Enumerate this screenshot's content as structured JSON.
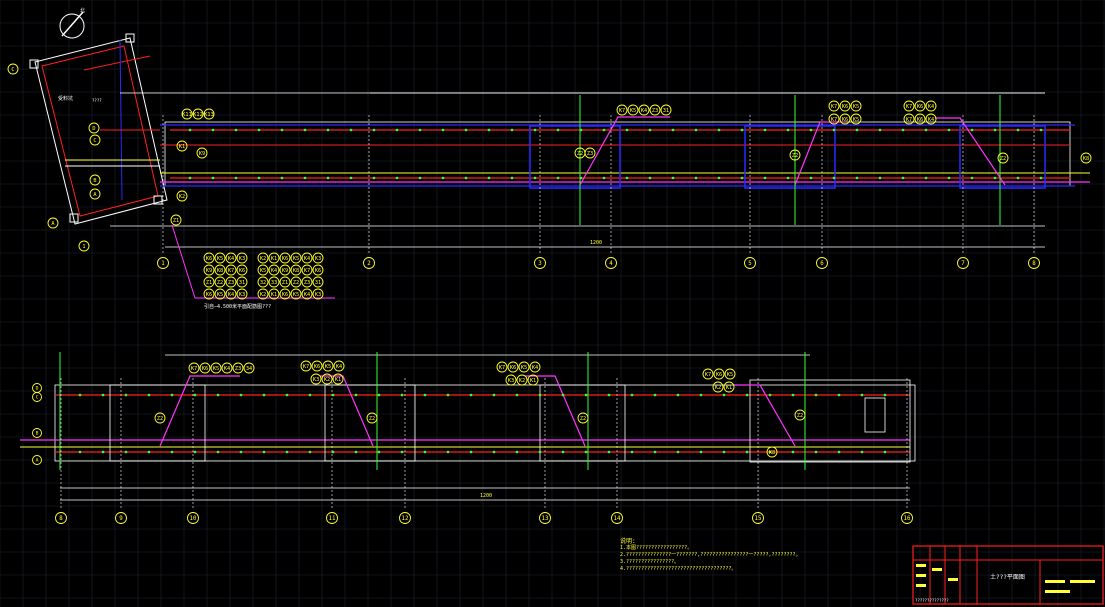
{
  "drawing": {
    "colors": {
      "background": "#000000",
      "grid": "#1e2430",
      "red": "#ff1f1f",
      "blue": "#2a2aff",
      "magenta": "#ff33ff",
      "yellow": "#ffff33",
      "white": "#ffffff",
      "green": "#33ff33",
      "cyan": "#33ffff"
    },
    "north_symbol": "north-arrow",
    "upper_axes": [
      "1",
      "2",
      "3",
      "4",
      "5",
      "6",
      "7",
      "8"
    ],
    "lower_axes": [
      "8",
      "9",
      "10",
      "11",
      "12",
      "13",
      "14",
      "15",
      "16"
    ],
    "row_axes_upper": [
      "D",
      "C",
      "B",
      "A"
    ],
    "row_axes_lower": [
      "D",
      "C",
      "B",
      "A"
    ],
    "tower_axes": [
      "C",
      "B",
      "A"
    ],
    "upper_total_dim": "1200",
    "lower_total_dim": "1200",
    "elevation_note": "引自—4.500米平面配筋图???",
    "notes_heading": "说明:",
    "notes": [
      "1.本图?????????????????。",
      "2.???????????????一???????,????????????????一?????,????????。",
      "3.????????????????。",
      "4.???????????????????????????????????。"
    ],
    "title_block_title": "土???平面图",
    "title_block_footer": "??????????????",
    "upper_callouts": [
      [
        "K7",
        "K5",
        "K4",
        "Z3",
        "31"
      ],
      [
        "K7",
        "K6",
        "K5"
      ],
      [
        "K7",
        "K6",
        "K4"
      ],
      [
        "K11",
        "K12",
        "K13"
      ],
      [
        "K14",
        "K15",
        "K16",
        "K17"
      ]
    ],
    "lower_callouts": [
      [
        "K7",
        "K6",
        "K5",
        "K4",
        "Z3",
        "34"
      ],
      [
        "K7",
        "K6",
        "K5",
        "K4"
      ],
      [
        "K7",
        "K6",
        "K5",
        "K4"
      ],
      [
        "K7",
        "K6",
        "K5"
      ]
    ]
  }
}
